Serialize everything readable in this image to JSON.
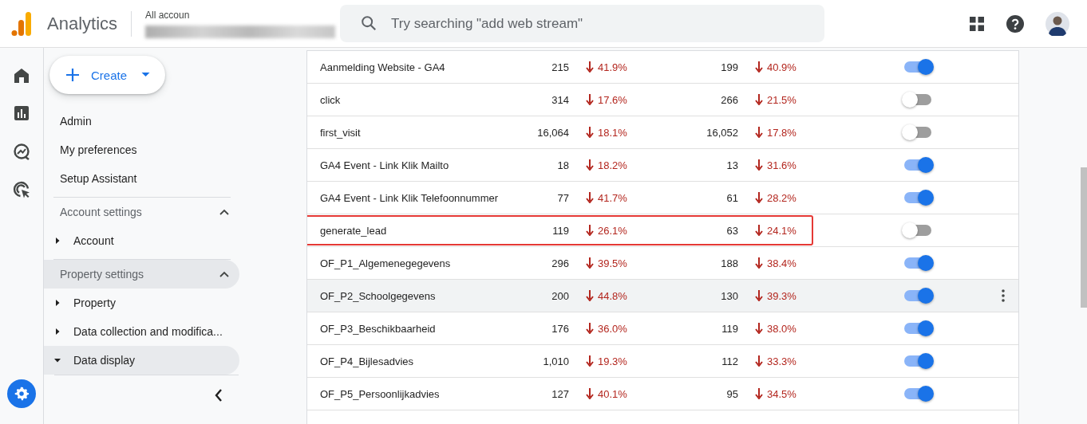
{
  "header": {
    "app_name": "Analytics",
    "breadcrumb": "All accoun",
    "search": {
      "placeholder": "Try searching \"add web stream\""
    }
  },
  "rail": [
    {
      "kind": "home"
    },
    {
      "kind": "reports"
    },
    {
      "kind": "explore"
    },
    {
      "kind": "advertising"
    }
  ],
  "nav": {
    "create_button": {
      "label": "Create"
    },
    "items": [
      {
        "kind": "link",
        "label": "Admin"
      },
      {
        "kind": "link",
        "label": "My preferences"
      },
      {
        "kind": "link",
        "label": "Setup Assistant"
      },
      {
        "kind": "section",
        "label": "Account settings",
        "expanded": true,
        "highlighted": false
      },
      {
        "kind": "tree",
        "label": "Account",
        "expanded": false,
        "selected": false
      },
      {
        "kind": "section",
        "label": "Property settings",
        "expanded": true,
        "highlighted": true
      },
      {
        "kind": "tree",
        "label": "Property",
        "expanded": false,
        "selected": false
      },
      {
        "kind": "tree",
        "label": "Data collection and modifica...",
        "expanded": false,
        "selected": false
      },
      {
        "kind": "tree",
        "label": "Data display",
        "expanded": true,
        "selected": true
      }
    ]
  },
  "table": {
    "rows": [
      {
        "name": "Aanmelding Website - GA4",
        "count_1": "215",
        "change_1": {
          "value": "41.9%",
          "down": true
        },
        "count_2": "199",
        "change_2": {
          "value": "40.9%",
          "down": true
        },
        "on": true,
        "hovered": false,
        "highlighted": false
      },
      {
        "name": "click",
        "count_1": "314",
        "change_1": {
          "value": "17.6%",
          "down": true
        },
        "count_2": "266",
        "change_2": {
          "value": "21.5%",
          "down": true
        },
        "on": false,
        "hovered": false,
        "highlighted": false
      },
      {
        "name": "first_visit",
        "count_1": "16,064",
        "change_1": {
          "value": "18.1%",
          "down": true
        },
        "count_2": "16,052",
        "change_2": {
          "value": "17.8%",
          "down": true
        },
        "on": false,
        "hovered": false,
        "highlighted": false
      },
      {
        "name": "GA4 Event - Link Klik Mailto",
        "count_1": "18",
        "change_1": {
          "value": "18.2%",
          "down": true
        },
        "count_2": "13",
        "change_2": {
          "value": "31.6%",
          "down": true
        },
        "on": true,
        "hovered": false,
        "highlighted": false
      },
      {
        "name": "GA4 Event - Link Klik Telefoonnummer",
        "count_1": "77",
        "change_1": {
          "value": "41.7%",
          "down": true
        },
        "count_2": "61",
        "change_2": {
          "value": "28.2%",
          "down": true
        },
        "on": true,
        "hovered": false,
        "highlighted": false
      },
      {
        "name": "generate_lead",
        "count_1": "119",
        "change_1": {
          "value": "26.1%",
          "down": true
        },
        "count_2": "63",
        "change_2": {
          "value": "24.1%",
          "down": true
        },
        "on": false,
        "hovered": false,
        "highlighted": true
      },
      {
        "name": "OF_P1_Algemenegegevens",
        "count_1": "296",
        "change_1": {
          "value": "39.5%",
          "down": true
        },
        "count_2": "188",
        "change_2": {
          "value": "38.4%",
          "down": true
        },
        "on": true,
        "hovered": false,
        "highlighted": false
      },
      {
        "name": "OF_P2_Schoolgegevens",
        "count_1": "200",
        "change_1": {
          "value": "44.8%",
          "down": true
        },
        "count_2": "130",
        "change_2": {
          "value": "39.3%",
          "down": true
        },
        "on": true,
        "hovered": true,
        "highlighted": false
      },
      {
        "name": "OF_P3_Beschikbaarheid",
        "count_1": "176",
        "change_1": {
          "value": "36.0%",
          "down": true
        },
        "count_2": "119",
        "change_2": {
          "value": "38.0%",
          "down": true
        },
        "on": true,
        "hovered": false,
        "highlighted": false
      },
      {
        "name": "OF_P4_Bijlesadvies",
        "count_1": "1,010",
        "change_1": {
          "value": "19.3%",
          "down": true
        },
        "count_2": "112",
        "change_2": {
          "value": "33.3%",
          "down": true
        },
        "on": true,
        "hovered": false,
        "highlighted": false
      },
      {
        "name": "OF_P5_Persoonlijkadvies",
        "count_1": "127",
        "change_1": {
          "value": "40.1%",
          "down": true
        },
        "count_2": "95",
        "change_2": {
          "value": "34.5%",
          "down": true
        },
        "on": true,
        "hovered": false,
        "highlighted": false
      }
    ]
  }
}
